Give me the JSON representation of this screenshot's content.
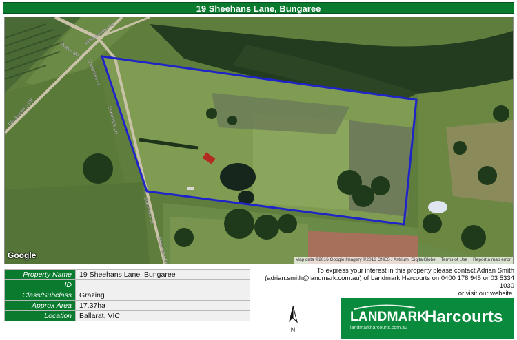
{
  "title": "19 Sheehans Lane, Bungaree",
  "map": {
    "google_logo": "Google",
    "attribution": "Map data ©2016 Google Imagery ©2016 CNES / Astrium, DigitalGlobe",
    "terms": "Terms of Use",
    "report": "Report a map error",
    "road_labels": {
      "sheehans_upper": "Sheehans Ln",
      "sheehans_mid": "Sheehans Ln",
      "sheehans_lower": "Sheehans Ln",
      "sheehans_bottom": "Sheehans Ln",
      "blackswamp_left": "Blackswamp Rd",
      "blackswamp_upper": "Blackswamp Rd",
      "road_top_left": "Peters Rd"
    },
    "boundary_color": "#1f24c8"
  },
  "details": [
    {
      "label": "Property Name",
      "value": "19 Sheehans Lane, Bungaree"
    },
    {
      "label": "ID",
      "value": ""
    },
    {
      "label": "Class/Subclass",
      "value": "Grazing"
    },
    {
      "label": "Approx Area",
      "value": "17.37ha"
    },
    {
      "label": "Location",
      "value": "Ballarat, VIC"
    }
  ],
  "contact": {
    "line1": "To express your interest in this property please contact Adrian Smith",
    "line2": "(adrian.smith@landmark.com.au) of Landmark Harcourts on 0400 178 945 or 03 5334 1030",
    "line3": "or visit our website.",
    "website": "www.landmarkharcourts.com.au"
  },
  "north_label": "N",
  "brand": {
    "landmark": "LANDMARK",
    "harcourts": "Harcourts",
    "url": "landmarkharcourts.com.au",
    "color": "#0a8a3c"
  }
}
